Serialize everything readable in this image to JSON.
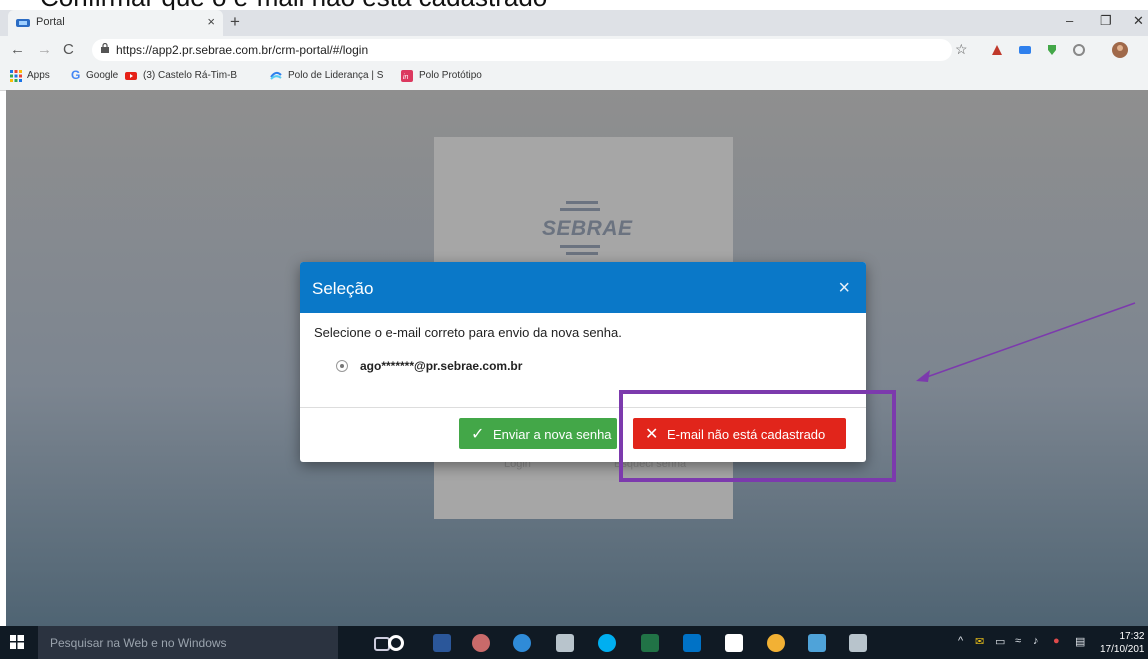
{
  "browser": {
    "top_fragment": "Confirmar que o e-mail não está cadastrado",
    "tab_title": "Portal",
    "tab_close": "×",
    "new_tab": "+",
    "url": "https://app2.pr.sebrae.com.br/crm-portal/#/login",
    "window_controls": [
      "–",
      "❐",
      "✕"
    ],
    "nav_icons": [
      "back-icon",
      "forward-icon",
      "reload-icon"
    ]
  },
  "bookmarks": [
    {
      "label": "Apps",
      "icon": "apps-grid-icon"
    },
    {
      "label": "Google",
      "icon": "google-icon"
    },
    {
      "label": "(3) Castelo Rá-Tim-B",
      "icon": "youtube-icon"
    },
    {
      "label": "Polo de Liderança | S",
      "icon": "polo-icon"
    },
    {
      "label": "Polo Protótipo",
      "icon": "invision-icon"
    }
  ],
  "login": {
    "logo_text": "SEBRAE",
    "login_link": "Login",
    "forgot_link": "Esqueci senha"
  },
  "modal": {
    "title": "Seleção",
    "close": "×",
    "message": "Selecione o e-mail correto para envio da nova senha.",
    "email_option": "ago*******@pr.sebrae.com.br",
    "send_button": "Enviar a nova senha",
    "not_registered_button": "E-mail não está cadastrado",
    "send_color": "#43a748",
    "not_registered_color": "#e1251b",
    "header_color": "#0a78c8"
  },
  "annotation": {
    "highlight_color": "#7c3aad"
  },
  "taskbar": {
    "search_placeholder": "Pesquisar na Web e no Windows",
    "time": "17:32",
    "date": "17/10/201",
    "apps": [
      "task-view-icon",
      "cortana-icon",
      "word-icon",
      "paint-icon",
      "edge-icon",
      "sketch-icon",
      "skype-icon",
      "excel-icon",
      "outlook-icon",
      "photos-icon",
      "chrome-icon",
      "app-icon",
      "tool-icon"
    ]
  }
}
